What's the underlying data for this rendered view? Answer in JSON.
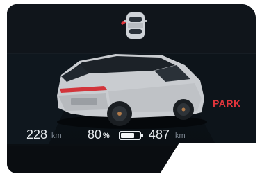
{
  "range_left": {
    "value": "228",
    "unit": "km"
  },
  "battery": {
    "percent_value": "80",
    "percent_sign": "%",
    "level": 0.8
  },
  "range_right": {
    "value": "487",
    "unit": "km"
  },
  "drive_mode": "PARK",
  "colors": {
    "accent_red": "#e0353c",
    "background": "#0b0f13",
    "text": "#e8ecef"
  },
  "icons": {
    "door_status": "car-top-view-door-open-icon",
    "battery": "battery-icon"
  }
}
